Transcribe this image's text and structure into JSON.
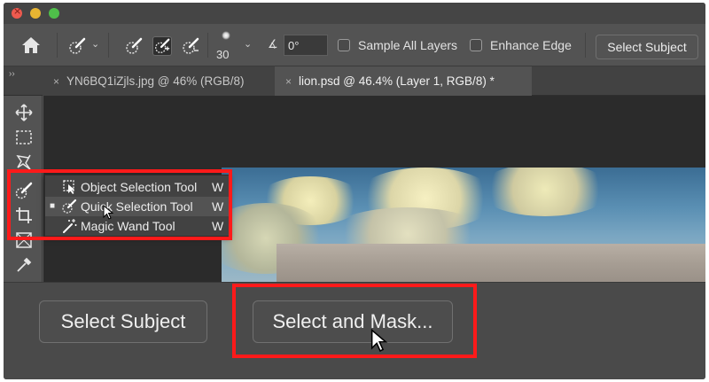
{
  "window": {
    "traffic_lights": [
      "close",
      "minimize",
      "zoom"
    ]
  },
  "options_bar": {
    "brush_size": "30",
    "angle_value": "0°",
    "sample_all_layers_label": "Sample All Layers",
    "enhance_edge_label": "Enhance Edge",
    "select_subject_label": "Select Subject"
  },
  "tabs": [
    {
      "label": "YN6BQ1iZjls.jpg @ 46% (RGB/8)",
      "active": false
    },
    {
      "label": "lion.psd @ 46.4% (Layer 1, RGB/8) *",
      "active": true
    }
  ],
  "flyout": {
    "items": [
      {
        "label": "Object Selection Tool",
        "shortcut": "W",
        "icon": "object-selection-icon",
        "selected": false
      },
      {
        "label": "Quick Selection Tool",
        "shortcut": "W",
        "icon": "quick-selection-icon",
        "selected": true
      },
      {
        "label": "Magic Wand Tool",
        "shortcut": "W",
        "icon": "magic-wand-icon",
        "selected": false
      }
    ]
  },
  "bottom_bar": {
    "select_subject_label": "Select Subject",
    "select_and_mask_label": "Select and Mask..."
  },
  "colors": {
    "highlight": "#ff1a1a",
    "panel": "#535353",
    "dark_panel": "#424242"
  }
}
